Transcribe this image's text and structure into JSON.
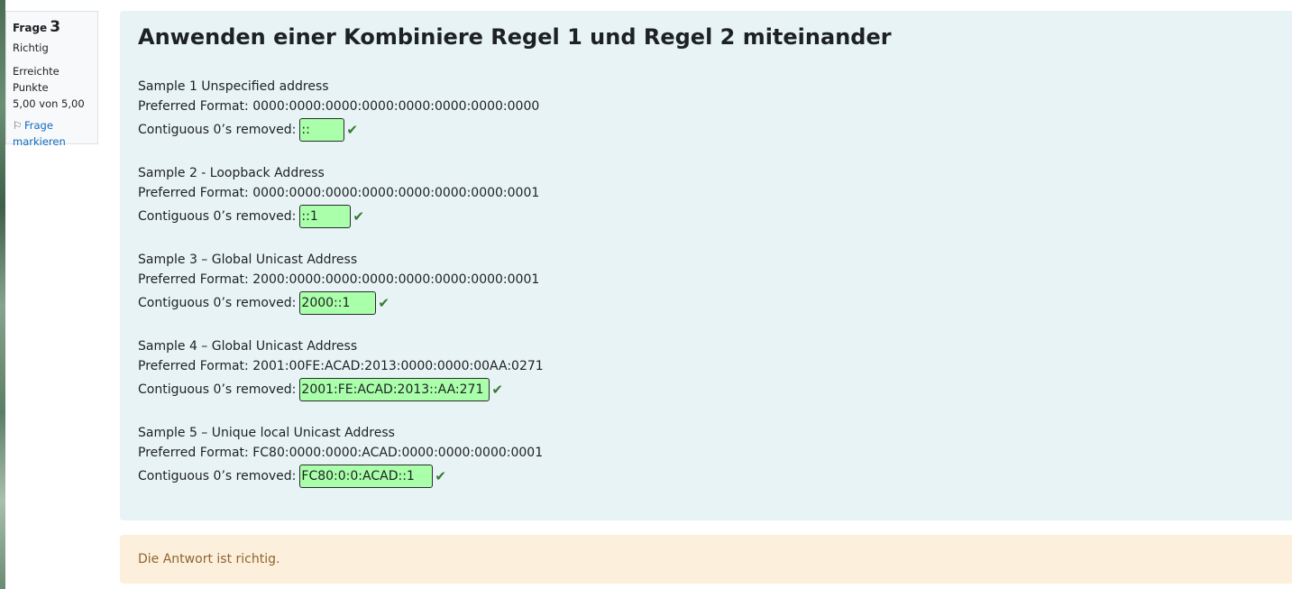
{
  "question_info": {
    "number_label": "Frage",
    "number": "3",
    "state": "Richtig",
    "grade_label": "Erreichte Punkte",
    "grade_value": "5,00 von 5,00",
    "flag_label_1": "Frage",
    "flag_label_2": "markieren"
  },
  "question": {
    "title": "Anwenden einer Kombiniere Regel 1 und Regel 2 miteinander",
    "samples": [
      {
        "heading": "Sample 1 Unspecified address",
        "preferred": "Preferred Format: 0000:0000:0000:0000:0000:0000:0000:0000",
        "removed_label": "Contiguous 0’s removed:",
        "answer": "::"
      },
      {
        "heading": "Sample 2 - Loopback Address",
        "preferred": "Preferred Format: 0000:0000:0000:0000:0000:0000:0000:0001",
        "removed_label": "Contiguous 0’s removed:",
        "answer": "::1"
      },
      {
        "heading": "Sample 3 – Global Unicast Address",
        "preferred": "Preferred Format: 2000:0000:0000:0000:0000:0000:0000:0001",
        "removed_label": "Contiguous 0’s removed:",
        "answer": "2000::1"
      },
      {
        "heading": "Sample 4 – Global Unicast Address",
        "preferred": "Preferred Format: 2001:00FE:ACAD:2013:0000:0000:00AA:0271",
        "removed_label": "Contiguous 0’s removed:",
        "answer": "2001:FE:ACAD:2013::AA:271"
      },
      {
        "heading": "Sample 5 – Unique local Unicast Address",
        "preferred": "Preferred Format: FC80:0000:0000:ACAD:0000:0000:0000:0001",
        "removed_label": "Contiguous 0’s removed:",
        "answer": "FC80:0:0:ACAD::1"
      }
    ]
  },
  "feedback": {
    "text": "Die Antwort ist richtig."
  },
  "colors": {
    "content_bg": "#e7f3f5",
    "correct_input_bg": "#aaffaa",
    "check_green": "#357a32",
    "feedback_bg": "#fcefdc",
    "feedback_text": "#8e662e",
    "link_blue": "#0f6cbf"
  },
  "icons": {
    "flag": "flag-icon",
    "correct": "check-icon"
  }
}
